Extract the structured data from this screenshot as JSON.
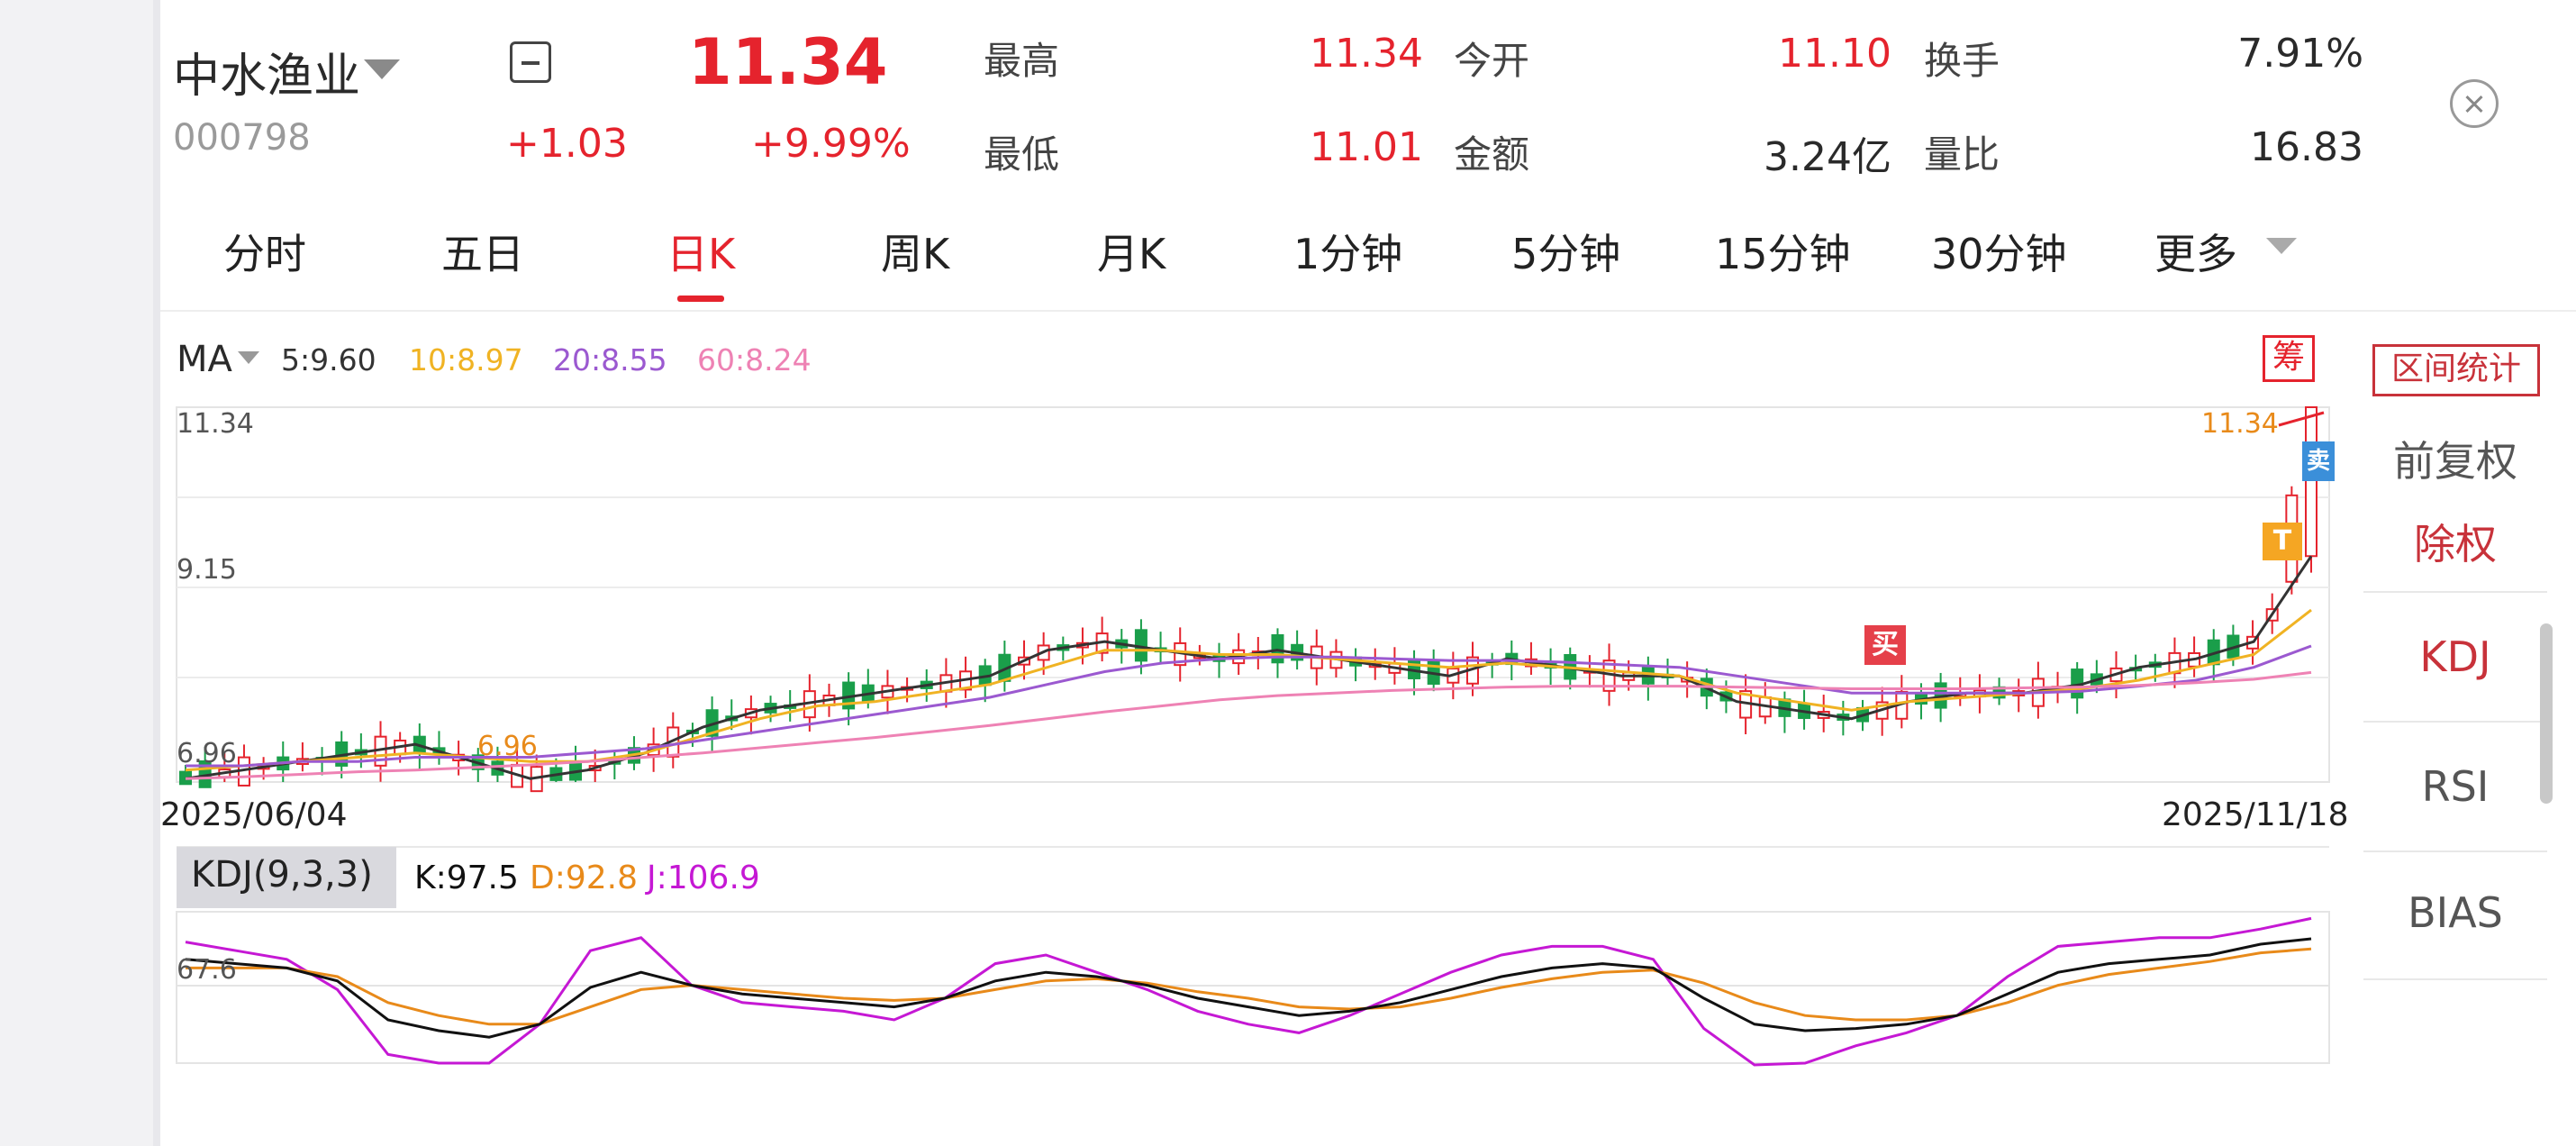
{
  "header": {
    "stock_name": "中水渔业",
    "stock_code": "000798",
    "price": "11.34",
    "change": "+1.03",
    "change_pct": "+9.99%",
    "stats": {
      "high_label": "最高",
      "high_value": "11.34",
      "open_label": "今开",
      "open_value": "11.10",
      "turnover_label": "换手",
      "turnover_value": "7.91%",
      "low_label": "最低",
      "low_value": "11.01",
      "amount_label": "金额",
      "amount_value": "3.24亿",
      "volume_ratio_label": "量比",
      "volume_ratio_value": "16.83"
    }
  },
  "tabs": [
    {
      "label": "分时"
    },
    {
      "label": "五日"
    },
    {
      "label": "日K",
      "active": true
    },
    {
      "label": "周K"
    },
    {
      "label": "月K"
    },
    {
      "label": "1分钟"
    },
    {
      "label": "5分钟"
    },
    {
      "label": "15分钟"
    },
    {
      "label": "30分钟"
    },
    {
      "label": "更多"
    }
  ],
  "ma": {
    "label": "MA",
    "items": [
      {
        "text": "5:9.60",
        "color": "#333333"
      },
      {
        "text": "10:8.97",
        "color": "#f0b323"
      },
      {
        "text": "20:8.55",
        "color": "#9b59d0"
      },
      {
        "text": "60:8.24",
        "color": "#ee82b4"
      }
    ],
    "chip_label": "筹"
  },
  "range_stats_button": "区间统计",
  "right_panel": {
    "items": [
      {
        "label": "前复权",
        "color": "#555555"
      },
      {
        "label": "除权",
        "color": "#c8323a"
      },
      {
        "label": "KDJ",
        "color": "#c8323a"
      },
      {
        "label": "RSI",
        "color": "#555555"
      },
      {
        "label": "BIAS",
        "color": "#555555"
      }
    ]
  },
  "price_chart": {
    "y_max_label": "11.34",
    "y_mid_label": "9.15",
    "y_min_label": "6.96",
    "last_price_label": "11.34",
    "min_price_marker": "6.96",
    "start_date": "2025/06/04",
    "end_date": "2025/11/18",
    "buy_badge": "买",
    "sell_badge": "卖",
    "t_badge": "T"
  },
  "kdj": {
    "title": "KDJ(9,3,3)",
    "k": "K:97.5",
    "d": "D:92.8",
    "j": "J:106.9",
    "y_label": "67.6",
    "colors": {
      "k": "#111111",
      "d": "#e88a1a",
      "j": "#c518d4"
    }
  },
  "chart_data": {
    "type": "line",
    "series": [
      {
        "name": "MA5",
        "values": [
          7.0,
          7.1,
          7.2,
          7.3,
          7.4,
          7.2,
          7.0,
          7.1,
          7.3,
          7.6,
          7.8,
          7.9,
          8.0,
          8.1,
          8.2,
          8.5,
          8.6,
          8.5,
          8.4,
          8.5,
          8.4,
          8.3,
          8.2,
          8.4,
          8.3,
          8.2,
          8.2,
          7.9,
          7.8,
          7.7,
          7.9,
          8.0,
          8.0,
          8.1,
          8.3,
          8.4,
          8.6,
          9.6
        ]
      },
      {
        "name": "MA10",
        "values": [
          7.1,
          7.15,
          7.2,
          7.25,
          7.3,
          7.25,
          7.2,
          7.2,
          7.3,
          7.5,
          7.7,
          7.85,
          7.9,
          8.0,
          8.1,
          8.3,
          8.5,
          8.5,
          8.45,
          8.45,
          8.4,
          8.35,
          8.3,
          8.35,
          8.3,
          8.25,
          8.2,
          8.0,
          7.9,
          7.8,
          7.9,
          7.95,
          8.0,
          8.05,
          8.15,
          8.3,
          8.45,
          8.97
        ]
      },
      {
        "name": "MA20",
        "values": [
          7.15,
          7.15,
          7.2,
          7.2,
          7.25,
          7.25,
          7.25,
          7.3,
          7.35,
          7.45,
          7.55,
          7.65,
          7.75,
          7.85,
          7.95,
          8.1,
          8.25,
          8.35,
          8.4,
          8.42,
          8.42,
          8.4,
          8.38,
          8.38,
          8.36,
          8.33,
          8.3,
          8.2,
          8.1,
          8.0,
          8.0,
          8.0,
          8.0,
          8.02,
          8.08,
          8.15,
          8.3,
          8.55
        ]
      },
      {
        "name": "MA60",
        "values": [
          7.0,
          7.02,
          7.05,
          7.08,
          7.1,
          7.13,
          7.16,
          7.2,
          7.25,
          7.3,
          7.36,
          7.42,
          7.48,
          7.55,
          7.62,
          7.7,
          7.78,
          7.85,
          7.92,
          7.97,
          8.0,
          8.03,
          8.05,
          8.07,
          8.08,
          8.08,
          8.08,
          8.07,
          8.06,
          8.05,
          8.05,
          8.05,
          8.06,
          8.07,
          8.09,
          8.12,
          8.16,
          8.24
        ]
      }
    ],
    "x_start": "2025/06/04",
    "x_end": "2025/11/18",
    "ylim": [
      6.96,
      11.34
    ],
    "kdj": {
      "k": [
        88,
        86,
        84,
        78,
        60,
        55,
        52,
        58,
        75,
        82,
        76,
        72,
        70,
        68,
        66,
        70,
        78,
        82,
        80,
        76,
        70,
        66,
        62,
        64,
        68,
        74,
        80,
        84,
        86,
        84,
        70,
        58,
        55,
        56,
        58,
        62,
        72,
        82,
        86,
        88,
        90,
        95,
        97.5
      ],
      "d": [
        84,
        84,
        84,
        80,
        68,
        62,
        58,
        58,
        66,
        74,
        76,
        74,
        72,
        70,
        69,
        70,
        74,
        78,
        79,
        77,
        73,
        70,
        66,
        65,
        66,
        70,
        75,
        79,
        82,
        83,
        77,
        68,
        62,
        60,
        60,
        62,
        68,
        76,
        81,
        84,
        87,
        91,
        92.8
      ],
      "j": [
        96,
        92,
        88,
        74,
        44,
        40,
        40,
        58,
        92,
        98,
        76,
        68,
        66,
        64,
        60,
        70,
        86,
        90,
        82,
        74,
        64,
        58,
        54,
        62,
        72,
        82,
        90,
        94,
        94,
        88,
        56,
        38,
        40,
        48,
        54,
        62,
        80,
        94,
        96,
        98,
        98,
        102,
        106.9
      ]
    }
  }
}
